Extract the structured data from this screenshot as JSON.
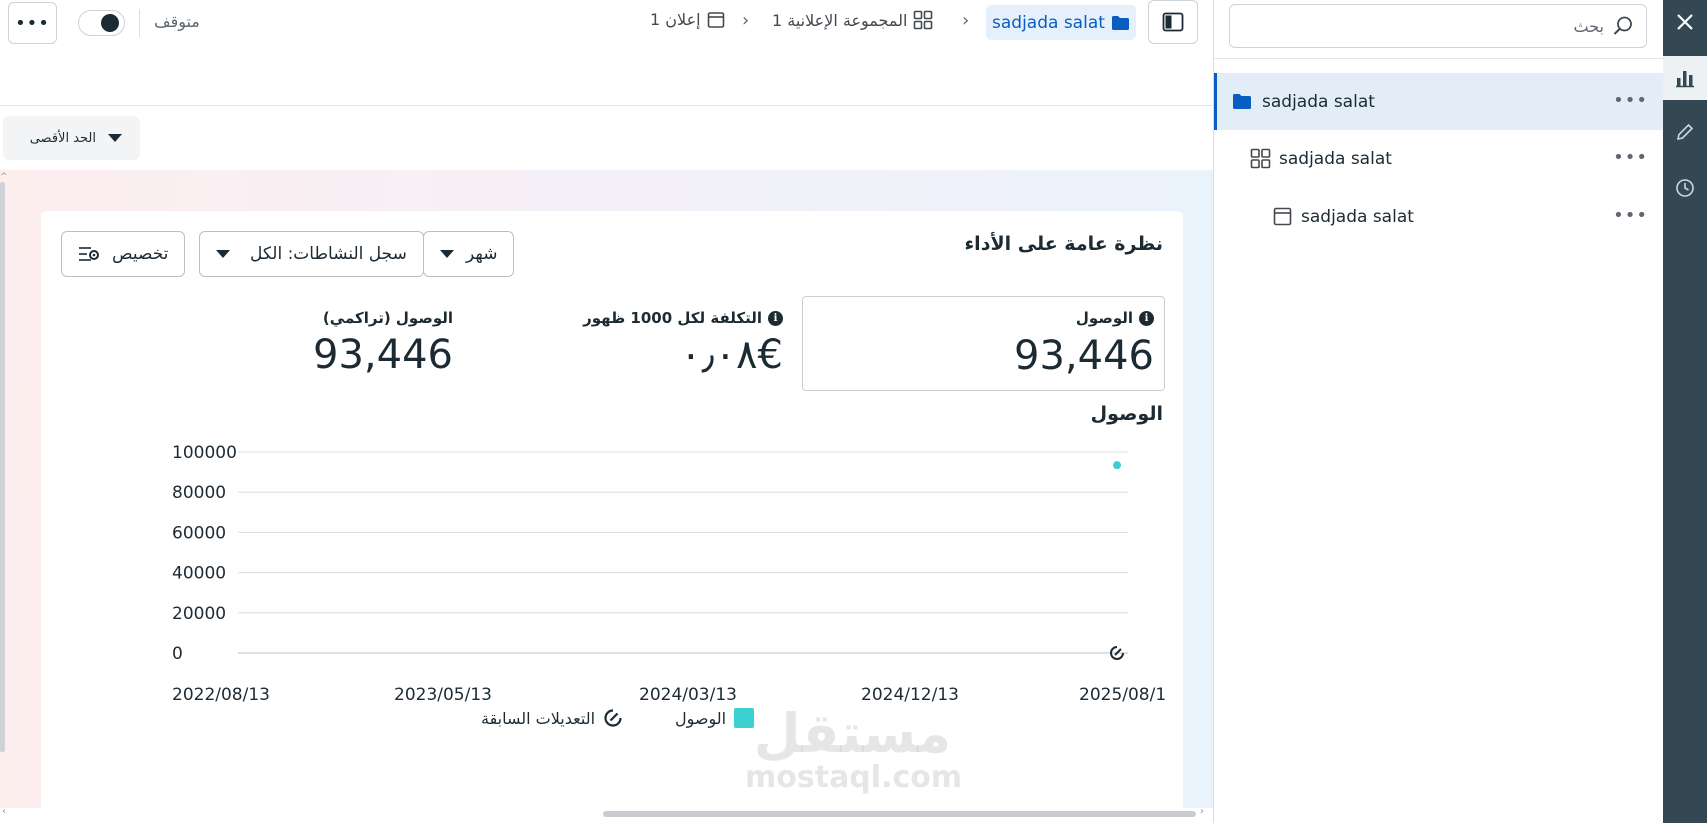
{
  "topbar": {
    "more_label": "•••",
    "status_label": "متوقف",
    "breadcrumb": {
      "ad_count": "1 إعلان",
      "adset_count": "1 المجموعة الإعلانية",
      "campaign_name": "sadjada salat"
    }
  },
  "filter": {
    "max_label": "الحد الأقصى"
  },
  "card": {
    "title": "نظرة عامة على الأداء",
    "buttons": {
      "period": "شهر",
      "activity_log": "سجل النشاطات: الكل",
      "customize": "تخصيص"
    },
    "metrics": [
      {
        "label": "الوصول",
        "value": "93,446"
      },
      {
        "label": "التكلفة لكل 1000 ظهور",
        "value": "٠٫٠٨€"
      },
      {
        "label": "الوصول (تراكمي)",
        "value": "93,446"
      }
    ],
    "chart_title": "الوصول",
    "legend": {
      "reach": "الوصول",
      "prev_edits": "التعديلات السابقة"
    }
  },
  "chart_data": {
    "type": "scatter",
    "x_ticks": [
      "2022/08/13",
      "2023/05/13",
      "2024/03/13",
      "2024/12/13",
      "2025/08/1"
    ],
    "y_ticks": [
      0,
      20000,
      40000,
      60000,
      80000,
      100000
    ],
    "ylim": [
      0,
      100000
    ],
    "grid": true,
    "legend_position": "bottom",
    "series": [
      {
        "name": "الوصول",
        "color": "#3bcfcf",
        "points": [
          {
            "x": "2025/08/1",
            "y": 93446
          }
        ]
      }
    ],
    "markers": [
      {
        "name": "التعديلات السابقة",
        "x": "2025/08/1"
      }
    ]
  },
  "sidebar": {
    "search_placeholder": "بحث",
    "tree": [
      {
        "label": "sadjada salat",
        "icon": "folder-icon",
        "selected": true
      },
      {
        "label": "sadjada salat",
        "icon": "adset-grid-icon",
        "selected": false
      },
      {
        "label": "sadjada salat",
        "icon": "ad-window-icon",
        "selected": false
      }
    ],
    "more_label": "•••"
  },
  "watermark": {
    "ar": "مستقل",
    "en": "mostaql.com"
  },
  "colors": {
    "accent": "#0a5dc2",
    "series": "#3bcfcf",
    "rail": "#344854"
  }
}
